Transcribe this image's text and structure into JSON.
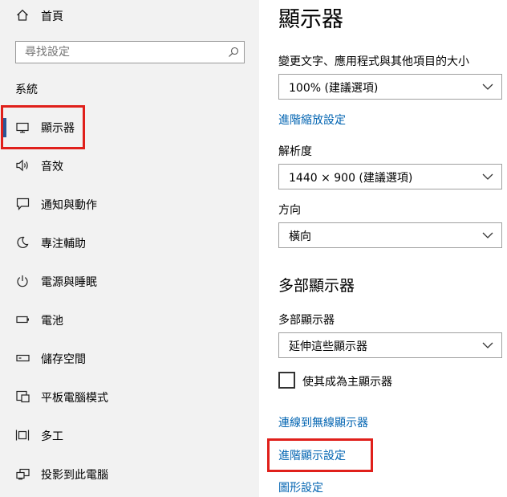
{
  "sidebar": {
    "home_label": "首頁",
    "search": {
      "placeholder": "尋找設定",
      "icon": "search-icon"
    },
    "section_title": "系統",
    "items": [
      {
        "label": "顯示器",
        "icon": "monitor-icon",
        "selected": true
      },
      {
        "label": "音效",
        "icon": "speaker-icon"
      },
      {
        "label": "通知與動作",
        "icon": "notification-icon"
      },
      {
        "label": "專注輔助",
        "icon": "moon-icon"
      },
      {
        "label": "電源與睡眠",
        "icon": "power-icon"
      },
      {
        "label": "電池",
        "icon": "battery-icon"
      },
      {
        "label": "儲存空間",
        "icon": "storage-icon"
      },
      {
        "label": "平板電腦模式",
        "icon": "tablet-mode-icon"
      },
      {
        "label": "多工",
        "icon": "multitasking-icon"
      },
      {
        "label": "投影到此電腦",
        "icon": "project-icon"
      }
    ]
  },
  "main": {
    "title": "顯示器",
    "scale_label": "變更文字、應用程式與其他項目的大小",
    "scale_value": "100% (建議選項)",
    "advanced_scaling_link": "進階縮放設定",
    "resolution_label": "解析度",
    "resolution_value": "1440 × 900 (建議選項)",
    "orientation_label": "方向",
    "orientation_value": "橫向",
    "multiple_displays_title": "多部顯示器",
    "multiple_displays_label": "多部顯示器",
    "multiple_displays_value": "延伸這些顯示器",
    "main_display_checkbox_label": "使其成為主顯示器",
    "main_display_checked": false,
    "wireless_link": "連線到無線顯示器",
    "advanced_display_link": "進階顯示設定",
    "graphics_link": "圖形設定"
  },
  "colors": {
    "sidebar_bg": "#f2f2f2",
    "link": "#0063b1",
    "highlight_box": "#e0201b",
    "selection_bar": "#2b5797"
  }
}
